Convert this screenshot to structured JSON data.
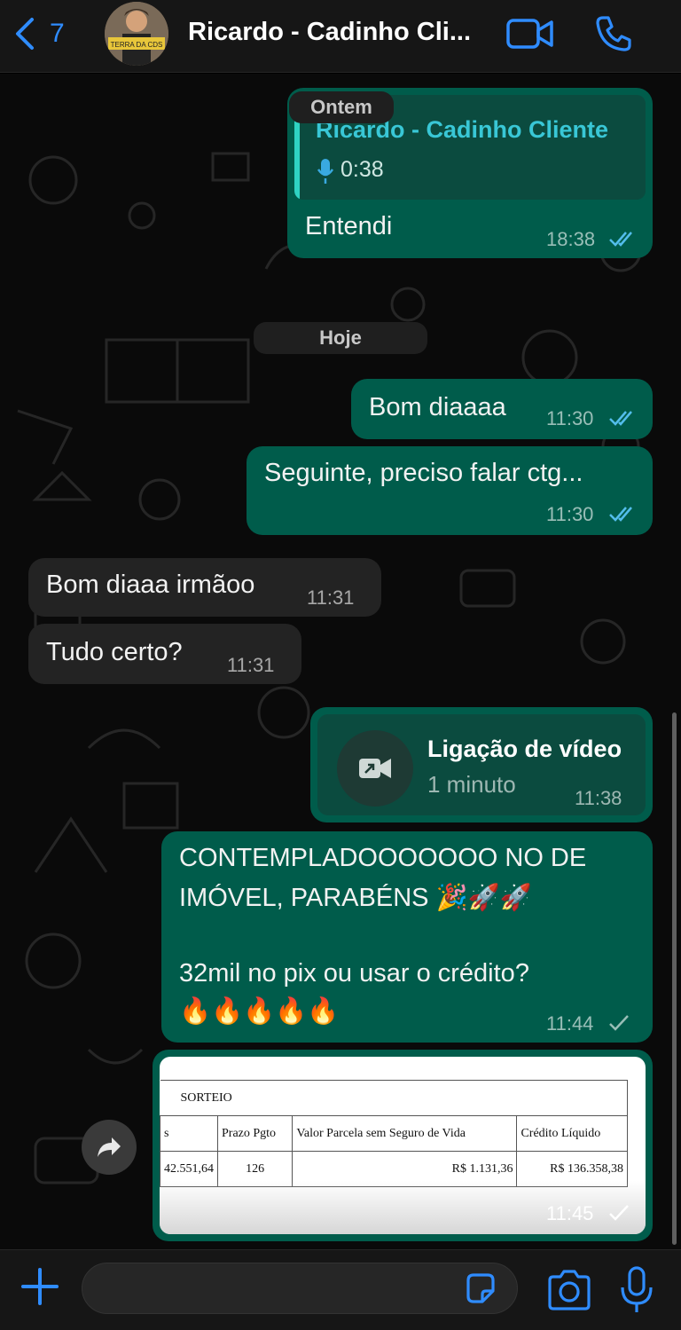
{
  "header": {
    "back_count": "7",
    "contact_name": "Ricardo - Cadinho Cli...",
    "avatar_caption": "TERRA DA CDS"
  },
  "dates": {
    "yesterday": "Ontem",
    "today": "Hoje"
  },
  "messages": [
    {
      "direction": "out",
      "quoted_name": "Ricardo - Cadinho Cliente",
      "quoted_audio_duration": "0:38",
      "text": "Entendi",
      "time": "18:38",
      "status": "read"
    },
    {
      "direction": "out",
      "text": "Bom diaaaa",
      "time": "11:30",
      "status": "read"
    },
    {
      "direction": "out",
      "text": "Seguinte, preciso falar ctg...",
      "time": "11:30",
      "status": "read"
    },
    {
      "direction": "in",
      "text": "Bom diaaa irmãoo",
      "time": "11:31"
    },
    {
      "direction": "in",
      "text": "Tudo certo?",
      "time": "11:31"
    },
    {
      "direction": "out",
      "call_title": "Ligação de vídeo",
      "call_duration": "1 minuto",
      "time": "11:38"
    },
    {
      "direction": "out",
      "line1": "CONTEMPLADOOOOOOO NO DE",
      "line2": "IMÓVEL, PARABÉNS 🎉🚀🚀",
      "line3": "32mil no pix ou usar o crédito?",
      "line4": "🔥🔥🔥🔥🔥",
      "time": "11:44",
      "status": "sent"
    },
    {
      "direction": "out",
      "document": {
        "section": "SORTEIO",
        "headers": [
          "s",
          "Prazo Pgto",
          "Valor Parcela sem Seguro de Vida",
          "Crédito Líquido"
        ],
        "row": [
          "42.551,64",
          "126",
          "R$ 1.131,36",
          "R$ 136.358,38"
        ]
      },
      "time": "11:45",
      "status": "sent"
    }
  ],
  "input": {
    "placeholder": ""
  },
  "colors": {
    "outgoing_bubble": "#005c4b",
    "incoming_bubble": "#232323",
    "accent_blue": "#2f8cff",
    "read_tick": "#53bdeb"
  }
}
